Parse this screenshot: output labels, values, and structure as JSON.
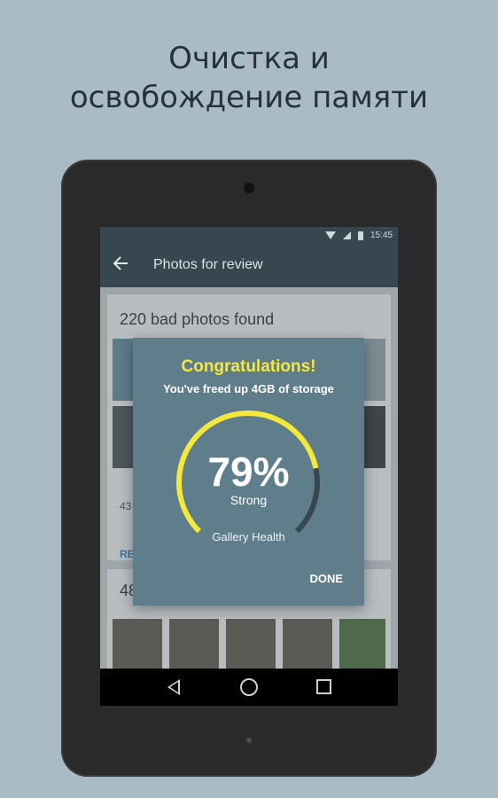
{
  "headline": {
    "line1": "Очистка и",
    "line2": "освобождение памяти"
  },
  "statusbar": {
    "time": "15:45"
  },
  "appbar": {
    "back_icon": "arrow-left-icon",
    "title": "Photos for review"
  },
  "cards": {
    "card1": {
      "title": "220 bad photos found",
      "small": "43",
      "link": "RE"
    },
    "card2": {
      "title": "48"
    }
  },
  "dialog": {
    "title": "Congratulations!",
    "subtitle": "You've freed up 4GB of storage",
    "gauge": {
      "value_label": "79%",
      "percent": 79,
      "status": "Strong",
      "caption": "Gallery Health",
      "fill_color": "#f5e83c",
      "track_color": "#37474f"
    },
    "done_label": "DONE"
  },
  "colors": {
    "page_bg": "#a9bcc6",
    "appbar": "#37474f",
    "dialog_bg": "#607d8b",
    "accent_yellow": "#f5e83c"
  }
}
